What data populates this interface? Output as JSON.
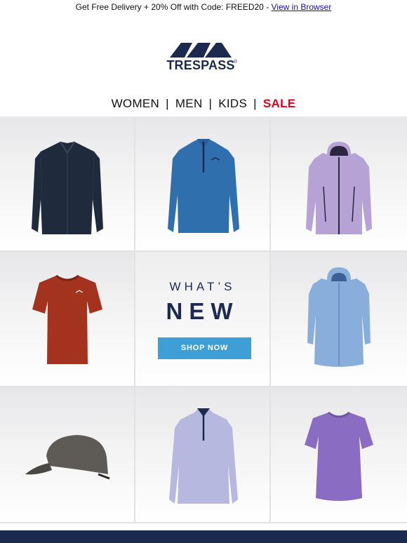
{
  "topbar": {
    "promo_text": "Get Free Delivery + 20% Off with Code: FREED20 - ",
    "view_in_browser": "View in Browser"
  },
  "logo": {
    "text": "TRESPASS",
    "reg_mark": "®"
  },
  "nav": {
    "women": "WOMEN",
    "men": "MEN",
    "kids": "KIDS",
    "sale": "SALE",
    "separator": "|"
  },
  "whats_new": {
    "line1": "WHAT’S",
    "line2": "NEW",
    "button": "SHOP NOW"
  },
  "colors": {
    "navy": "#1b2a4e",
    "sale_red": "#e3001b",
    "button_blue": "#3d9fd6"
  },
  "products": [
    {
      "name": "navy-overshirt-jacket",
      "color": "#1f2a3c"
    },
    {
      "name": "blue-fleece-half-zip",
      "color": "#2f6fae"
    },
    {
      "name": "lilac-softshell-jacket",
      "color": "#b7a2d6"
    },
    {
      "name": "red-marl-tshirt",
      "color": "#a3331f"
    },
    {
      "name": "light-blue-long-jacket",
      "color": "#89aedc"
    },
    {
      "name": "grey-cap",
      "color": "#5e5a55"
    },
    {
      "name": "lavender-fleece-half-zip",
      "color": "#b7b8e0"
    },
    {
      "name": "purple-marl-tshirt",
      "color": "#8a6cc3"
    }
  ]
}
